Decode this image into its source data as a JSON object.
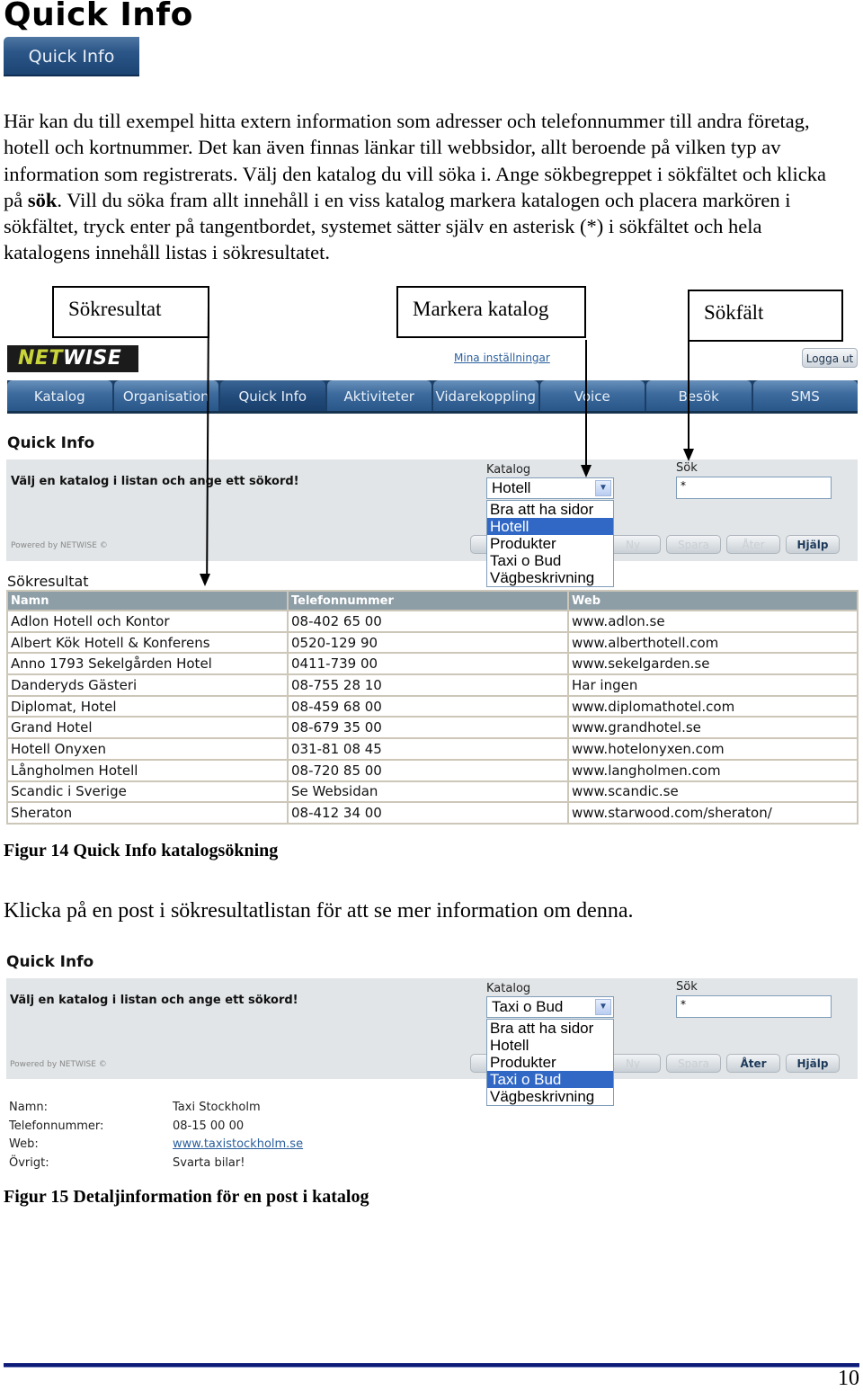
{
  "doc": {
    "heading": "Quick Info",
    "heading_button": "Quick Info",
    "intro": {
      "part1": "Här kan du till exempel hitta extern information som adresser och telefonnummer till andra företag, hotell och kortnummer. Det kan även finnas länkar till webbsidor, allt beroende på vilken typ av information som registrerats. Välj den katalog du vill söka i. Ange sökbegreppet i sökfältet och klicka på ",
      "bold": "sök",
      "part2": ". Vill du söka fram allt innehåll i en viss katalog markera katalogen och placera markören i sökfältet, tryck enter på tangentbordet, systemet sätter själv en asterisk (*) i sökfältet och hela katalogens innehåll listas i sökresultatet."
    },
    "callouts": {
      "results": "Sökresultat",
      "catalog": "Markera katalog",
      "search": "Sökfält"
    },
    "figure14_caption": "Figur 14  Quick Info katalogsökning",
    "between_text": "Klicka på en post i sökresultatlistan för att se mer information om denna.",
    "figure15_caption": "Figur 15  Detaljinformation för en post i katalog",
    "page_number": "10"
  },
  "app": {
    "logo": {
      "part1": "NET",
      "part2": "WISE"
    },
    "settings_link": "Mina inställningar",
    "logout_button": "Logga ut",
    "nav_tabs": [
      {
        "label": "Katalog",
        "active": false
      },
      {
        "label": "Organisation",
        "active": false
      },
      {
        "label": "Quick Info",
        "active": true
      },
      {
        "label": "Aktiviteter",
        "active": false
      },
      {
        "label": "Vidarekoppling",
        "active": false
      },
      {
        "label": "Voice",
        "active": false
      },
      {
        "label": "Besök",
        "active": false
      },
      {
        "label": "SMS",
        "active": false
      }
    ],
    "colors": {
      "accent": "#2a578a",
      "selection": "#3168c5",
      "panel": "#e1e5e7",
      "table_header": "#8e9ea7",
      "footer_rule": "#0c1a78"
    }
  },
  "fig14": {
    "title": "Quick Info",
    "message": "Välj en katalog i listan och ange ett sökord!",
    "powered": "Powered by NETWISE ©",
    "catalog_label": "Katalog",
    "catalog_value": "Hotell",
    "search_label": "Sök",
    "search_value": "*",
    "dropdown_options": [
      "Bra att ha sidor",
      "Hotell",
      "Produkter",
      "Taxi o Bud",
      "Vägbeskrivning"
    ],
    "dropdown_selected_index": 1,
    "buttons": {
      "new": "Ny",
      "save": "Spara",
      "back": "Åter",
      "help": "Hjälp"
    },
    "results_title": "Sökresultat",
    "columns": [
      "Namn",
      "Telefonnummer",
      "Web"
    ],
    "rows": [
      [
        "Adlon Hotell och Kontor",
        "08-402 65 00",
        "www.adlon.se"
      ],
      [
        "Albert Kök Hotell & Konferens",
        "0520-129 90",
        "www.alberthotell.com"
      ],
      [
        "Anno 1793 Sekelgården Hotel",
        "0411-739 00",
        "www.sekelgarden.se"
      ],
      [
        "Danderyds Gästeri",
        "08-755 28 10",
        "Har ingen"
      ],
      [
        "Diplomat, Hotel",
        "08-459 68 00",
        "www.diplomathotel.com"
      ],
      [
        "Grand Hotel",
        "08-679 35 00",
        "www.grandhotel.se"
      ],
      [
        "Hotell Onyxen",
        "031-81 08 45",
        "www.hotelonyxen.com"
      ],
      [
        "Långholmen Hotell",
        "08-720 85 00",
        "www.langholmen.com"
      ],
      [
        "Scandic i Sverige",
        "Se Websidan",
        "www.scandic.se"
      ],
      [
        "Sheraton",
        "08-412 34 00",
        "www.starwood.com/sheraton/"
      ]
    ]
  },
  "fig15": {
    "title": "Quick Info",
    "message": "Välj en katalog i listan och ange ett sökord!",
    "powered": "Powered by NETWISE ©",
    "catalog_label": "Katalog",
    "catalog_value": "Taxi o Bud",
    "search_label": "Sök",
    "search_value": "*",
    "dropdown_options": [
      "Bra att ha sidor",
      "Hotell",
      "Produkter",
      "Taxi o Bud",
      "Vägbeskrivning"
    ],
    "dropdown_selected_index": 3,
    "buttons": {
      "new": "Ny",
      "save": "Spara",
      "back": "Åter",
      "help": "Hjälp"
    },
    "details": [
      {
        "label": "Namn:",
        "value": "Taxi Stockholm",
        "link": false
      },
      {
        "label": "Telefonnummer:",
        "value": "08-15 00 00",
        "link": false
      },
      {
        "label": "Web:",
        "value": "www.taxistockholm.se",
        "link": true
      },
      {
        "label": "Övrigt:",
        "value": "Svarta bilar!",
        "link": false
      }
    ]
  }
}
